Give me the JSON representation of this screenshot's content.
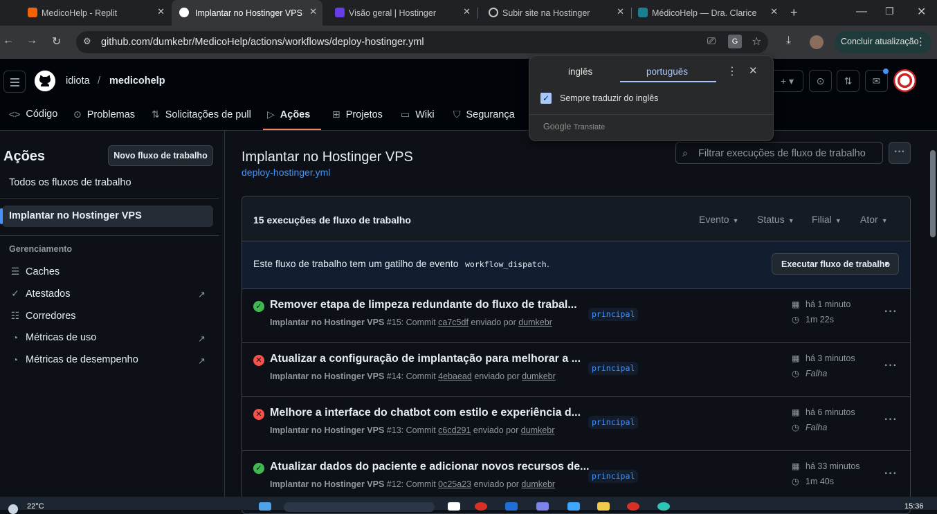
{
  "browser": {
    "tabs": [
      {
        "title": "MedicoHelp - Replit",
        "icon": "replit-icon",
        "color": "#f26207"
      },
      {
        "title": "Implantar no Hostinger VPS",
        "icon": "github-icon",
        "color": "#ffffff"
      },
      {
        "title": "Visão geral | Hostinger",
        "icon": "hostinger-icon",
        "color": "#673de6"
      },
      {
        "title": "Subir site na Hostinger",
        "icon": "chatgpt-icon",
        "color": "#c4c7c5"
      },
      {
        "title": "MédicoHelp — Dra. Clarice",
        "icon": "medicohelp-icon",
        "color": "#1a7f8e"
      }
    ],
    "url": "github.com/dumkebr/MedicoHelp/actions/workflows/deploy-hostinger.yml",
    "update_label": "Concluir atualização"
  },
  "translate": {
    "lang_from": "inglês",
    "lang_to": "português",
    "always_translate": "Sempre traduzir do inglês",
    "brand": "Google Translate",
    "brand_google": "Google",
    "brand_translate": "Translate"
  },
  "header": {
    "owner": "idiota",
    "separator": "/",
    "repo": "medicohelp",
    "nav": [
      {
        "label": "Código",
        "icon": "code-icon"
      },
      {
        "label": "Problemas",
        "icon": "issue-icon"
      },
      {
        "label": "Solicitações de pull",
        "icon": "pull-request-icon"
      },
      {
        "label": "Ações",
        "icon": "play-icon",
        "active": true
      },
      {
        "label": "Projetos",
        "icon": "table-icon"
      },
      {
        "label": "Wiki",
        "icon": "book-icon"
      },
      {
        "label": "Segurança",
        "icon": "shield-icon"
      }
    ]
  },
  "sidebar": {
    "title": "Ações",
    "new_workflow": "Novo fluxo de trabalho",
    "all_workflows": "Todos os fluxos de trabalho",
    "active_workflow": "Implantar no Hostinger VPS",
    "management_heading": "Gerenciamento",
    "management": [
      {
        "label": "Caches",
        "icon": "database-icon"
      },
      {
        "label": "Atestados",
        "icon": "verified-icon",
        "external": true
      },
      {
        "label": "Corredores",
        "icon": "server-icon"
      },
      {
        "label": "Métricas de uso",
        "icon": "meter-icon",
        "external": true
      },
      {
        "label": "Métricas de desempenho",
        "icon": "meter-icon",
        "external": true
      }
    ]
  },
  "main": {
    "title": "Implantar no Hostinger VPS",
    "file": "deploy-hostinger.yml",
    "filter_placeholder": "Filtrar execuções de fluxo de trabalho",
    "runs_count": "15 execuções de fluxo de trabalho",
    "filters": [
      "Evento",
      "Status",
      "Filial",
      "Ator"
    ],
    "dispatch_text": "Este fluxo de trabalho tem um gatilho de evento",
    "dispatch_code": "workflow_dispatch",
    "dispatch_end": ".",
    "run_button": "Executar fluxo de trabalho",
    "runs": [
      {
        "status": "success",
        "title": "Remover etapa de limpeza redundante do fluxo de trabal...",
        "workflow": "Implantar no Hostinger VPS",
        "number": "#15",
        "commit_word": "Commit",
        "commit": "ca7c5df",
        "pushed_by": "enviado por",
        "actor": "dumkebr",
        "branch": "principal",
        "time": "há 1 minuto",
        "duration": "1m 22s"
      },
      {
        "status": "failure",
        "title": "Atualizar a configuração de implantação para melhorar a ...",
        "workflow": "Implantar no Hostinger VPS",
        "number": "#14",
        "commit_word": "Commit",
        "commit": "4ebaead",
        "pushed_by": "enviado por",
        "actor": "dumkebr",
        "branch": "principal",
        "time": "há 3 minutos",
        "duration": "Falha"
      },
      {
        "status": "failure",
        "title": "Melhore a interface do chatbot com estilo e experiência d...",
        "workflow": "Implantar no Hostinger VPS",
        "number": "#13",
        "commit_word": "Commit",
        "commit": "c6cd291",
        "pushed_by": "enviado por",
        "actor": "dumkebr",
        "branch": "principal",
        "time": "há 6 minutos",
        "duration": "Falha"
      },
      {
        "status": "success",
        "title": "Atualizar dados do paciente e adicionar novos recursos de...",
        "workflow": "Implantar no Hostinger VPS",
        "number": "#12",
        "commit_word": "Commit",
        "commit": "0c25a23",
        "pushed_by": "enviado por",
        "actor": "dumkebr",
        "branch": "principal",
        "time": "há 33 minutos",
        "duration": "1m 40s"
      }
    ]
  },
  "taskbar": {
    "temperature": "22°C",
    "clock": "15:36"
  }
}
